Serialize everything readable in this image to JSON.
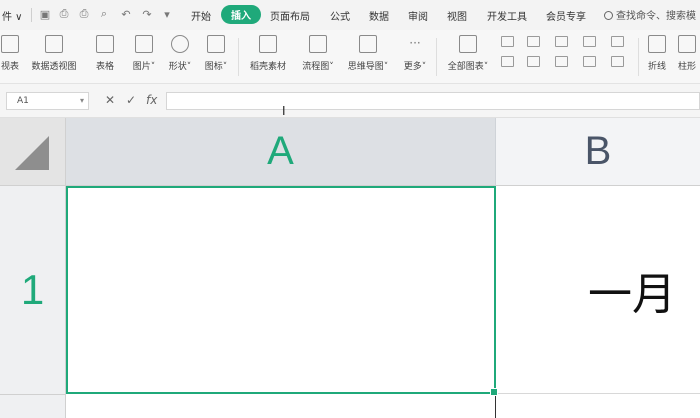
{
  "menubar": {
    "file_label": "件 ∨",
    "tabs": [
      {
        "label": "开始"
      },
      {
        "label": "插入",
        "active": true
      },
      {
        "label": "页面布局"
      },
      {
        "label": "公式"
      },
      {
        "label": "数据"
      },
      {
        "label": "审阅"
      },
      {
        "label": "视图"
      },
      {
        "label": "开发工具"
      },
      {
        "label": "会员专享"
      }
    ],
    "search_text": "查找命令、搜索模"
  },
  "ribbon": {
    "items": [
      {
        "label": "视表"
      },
      {
        "label": "数据透视图"
      },
      {
        "label": "表格"
      },
      {
        "label": "图片˅"
      },
      {
        "label": "形状˅"
      },
      {
        "label": "图标˅"
      },
      {
        "label": "稻壳素材"
      },
      {
        "label": "流程图˅"
      },
      {
        "label": "思维导图˅"
      },
      {
        "label": "更多˅"
      },
      {
        "label": "全部图表˅"
      },
      {
        "label": "折线"
      },
      {
        "label": "柱形"
      }
    ]
  },
  "formula_bar": {
    "cell_ref": "A1",
    "cancel": "✕",
    "confirm": "✓",
    "fx": "fx",
    "value": ""
  },
  "grid": {
    "columns": [
      "A",
      "B"
    ],
    "rows": [
      "1"
    ],
    "selected_cell": "A1",
    "cells": {
      "A1": "",
      "B1": "一月"
    }
  },
  "colors": {
    "accent": "#1fa97a",
    "header_selected": "#dde0e4",
    "header": "#f3f4f6"
  }
}
